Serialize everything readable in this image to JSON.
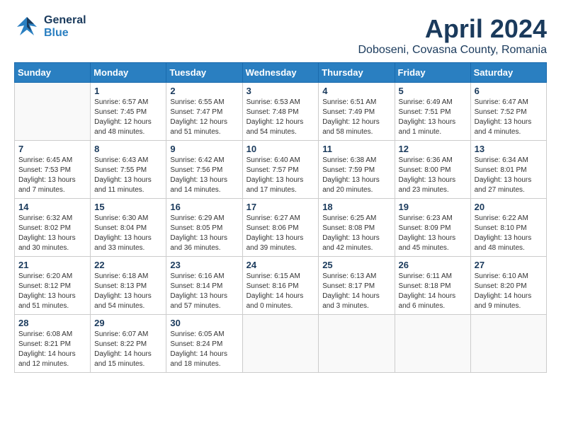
{
  "logo": {
    "line1": "General",
    "line2": "Blue"
  },
  "title": "April 2024",
  "location": "Doboseni, Covasna County, Romania",
  "days_of_week": [
    "Sunday",
    "Monday",
    "Tuesday",
    "Wednesday",
    "Thursday",
    "Friday",
    "Saturday"
  ],
  "weeks": [
    [
      {
        "day": "",
        "info": ""
      },
      {
        "day": "1",
        "info": "Sunrise: 6:57 AM\nSunset: 7:45 PM\nDaylight: 12 hours\nand 48 minutes."
      },
      {
        "day": "2",
        "info": "Sunrise: 6:55 AM\nSunset: 7:47 PM\nDaylight: 12 hours\nand 51 minutes."
      },
      {
        "day": "3",
        "info": "Sunrise: 6:53 AM\nSunset: 7:48 PM\nDaylight: 12 hours\nand 54 minutes."
      },
      {
        "day": "4",
        "info": "Sunrise: 6:51 AM\nSunset: 7:49 PM\nDaylight: 12 hours\nand 58 minutes."
      },
      {
        "day": "5",
        "info": "Sunrise: 6:49 AM\nSunset: 7:51 PM\nDaylight: 13 hours\nand 1 minute."
      },
      {
        "day": "6",
        "info": "Sunrise: 6:47 AM\nSunset: 7:52 PM\nDaylight: 13 hours\nand 4 minutes."
      }
    ],
    [
      {
        "day": "7",
        "info": "Sunrise: 6:45 AM\nSunset: 7:53 PM\nDaylight: 13 hours\nand 7 minutes."
      },
      {
        "day": "8",
        "info": "Sunrise: 6:43 AM\nSunset: 7:55 PM\nDaylight: 13 hours\nand 11 minutes."
      },
      {
        "day": "9",
        "info": "Sunrise: 6:42 AM\nSunset: 7:56 PM\nDaylight: 13 hours\nand 14 minutes."
      },
      {
        "day": "10",
        "info": "Sunrise: 6:40 AM\nSunset: 7:57 PM\nDaylight: 13 hours\nand 17 minutes."
      },
      {
        "day": "11",
        "info": "Sunrise: 6:38 AM\nSunset: 7:59 PM\nDaylight: 13 hours\nand 20 minutes."
      },
      {
        "day": "12",
        "info": "Sunrise: 6:36 AM\nSunset: 8:00 PM\nDaylight: 13 hours\nand 23 minutes."
      },
      {
        "day": "13",
        "info": "Sunrise: 6:34 AM\nSunset: 8:01 PM\nDaylight: 13 hours\nand 27 minutes."
      }
    ],
    [
      {
        "day": "14",
        "info": "Sunrise: 6:32 AM\nSunset: 8:02 PM\nDaylight: 13 hours\nand 30 minutes."
      },
      {
        "day": "15",
        "info": "Sunrise: 6:30 AM\nSunset: 8:04 PM\nDaylight: 13 hours\nand 33 minutes."
      },
      {
        "day": "16",
        "info": "Sunrise: 6:29 AM\nSunset: 8:05 PM\nDaylight: 13 hours\nand 36 minutes."
      },
      {
        "day": "17",
        "info": "Sunrise: 6:27 AM\nSunset: 8:06 PM\nDaylight: 13 hours\nand 39 minutes."
      },
      {
        "day": "18",
        "info": "Sunrise: 6:25 AM\nSunset: 8:08 PM\nDaylight: 13 hours\nand 42 minutes."
      },
      {
        "day": "19",
        "info": "Sunrise: 6:23 AM\nSunset: 8:09 PM\nDaylight: 13 hours\nand 45 minutes."
      },
      {
        "day": "20",
        "info": "Sunrise: 6:22 AM\nSunset: 8:10 PM\nDaylight: 13 hours\nand 48 minutes."
      }
    ],
    [
      {
        "day": "21",
        "info": "Sunrise: 6:20 AM\nSunset: 8:12 PM\nDaylight: 13 hours\nand 51 minutes."
      },
      {
        "day": "22",
        "info": "Sunrise: 6:18 AM\nSunset: 8:13 PM\nDaylight: 13 hours\nand 54 minutes."
      },
      {
        "day": "23",
        "info": "Sunrise: 6:16 AM\nSunset: 8:14 PM\nDaylight: 13 hours\nand 57 minutes."
      },
      {
        "day": "24",
        "info": "Sunrise: 6:15 AM\nSunset: 8:16 PM\nDaylight: 14 hours\nand 0 minutes."
      },
      {
        "day": "25",
        "info": "Sunrise: 6:13 AM\nSunset: 8:17 PM\nDaylight: 14 hours\nand 3 minutes."
      },
      {
        "day": "26",
        "info": "Sunrise: 6:11 AM\nSunset: 8:18 PM\nDaylight: 14 hours\nand 6 minutes."
      },
      {
        "day": "27",
        "info": "Sunrise: 6:10 AM\nSunset: 8:20 PM\nDaylight: 14 hours\nand 9 minutes."
      }
    ],
    [
      {
        "day": "28",
        "info": "Sunrise: 6:08 AM\nSunset: 8:21 PM\nDaylight: 14 hours\nand 12 minutes."
      },
      {
        "day": "29",
        "info": "Sunrise: 6:07 AM\nSunset: 8:22 PM\nDaylight: 14 hours\nand 15 minutes."
      },
      {
        "day": "30",
        "info": "Sunrise: 6:05 AM\nSunset: 8:24 PM\nDaylight: 14 hours\nand 18 minutes."
      },
      {
        "day": "",
        "info": ""
      },
      {
        "day": "",
        "info": ""
      },
      {
        "day": "",
        "info": ""
      },
      {
        "day": "",
        "info": ""
      }
    ]
  ]
}
